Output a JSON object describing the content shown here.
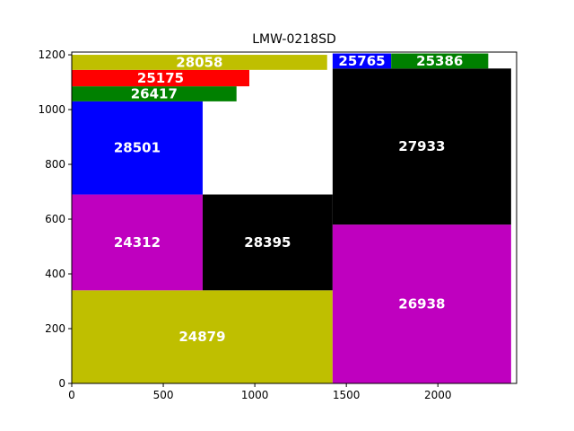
{
  "chart_data": {
    "type": "bar",
    "title": "LMW-0218SD",
    "xlabel": "",
    "ylabel": "",
    "xlim": [
      0,
      2430
    ],
    "ylim": [
      0,
      1210
    ],
    "xticks": [
      0,
      500,
      1000,
      1500,
      2000
    ],
    "yticks": [
      0,
      200,
      400,
      600,
      800,
      1000,
      1200
    ],
    "grid": false,
    "legend": "none",
    "rectangles": [
      {
        "label": "24879",
        "x0": 0,
        "x1": 1425,
        "y0": 0,
        "y1": 340,
        "color": "#bfbf00"
      },
      {
        "label": "24312",
        "x0": 0,
        "x1": 715,
        "y0": 340,
        "y1": 690,
        "color": "#bf00bf"
      },
      {
        "label": "28395",
        "x0": 715,
        "x1": 1425,
        "y0": 340,
        "y1": 690,
        "color": "#000000"
      },
      {
        "label": "28501",
        "x0": 0,
        "x1": 715,
        "y0": 690,
        "y1": 1030,
        "color": "#0000ff"
      },
      {
        "label": "26417",
        "x0": 0,
        "x1": 900,
        "y0": 1030,
        "y1": 1085,
        "color": "#008000"
      },
      {
        "label": "25175",
        "x0": 0,
        "x1": 970,
        "y0": 1085,
        "y1": 1145,
        "color": "#ff0000"
      },
      {
        "label": "28058",
        "x0": 0,
        "x1": 1395,
        "y0": 1145,
        "y1": 1200,
        "color": "#bfbf00"
      },
      {
        "label": "26938",
        "x0": 1425,
        "x1": 2400,
        "y0": 0,
        "y1": 580,
        "color": "#bf00bf"
      },
      {
        "label": "27933",
        "x0": 1425,
        "x1": 2400,
        "y0": 580,
        "y1": 1150,
        "color": "#000000"
      },
      {
        "label": "25765",
        "x0": 1425,
        "x1": 1745,
        "y0": 1150,
        "y1": 1205,
        "color": "#0000ff"
      },
      {
        "label": "25386",
        "x0": 1745,
        "x1": 2275,
        "y0": 1150,
        "y1": 1205,
        "color": "#008000"
      }
    ]
  }
}
